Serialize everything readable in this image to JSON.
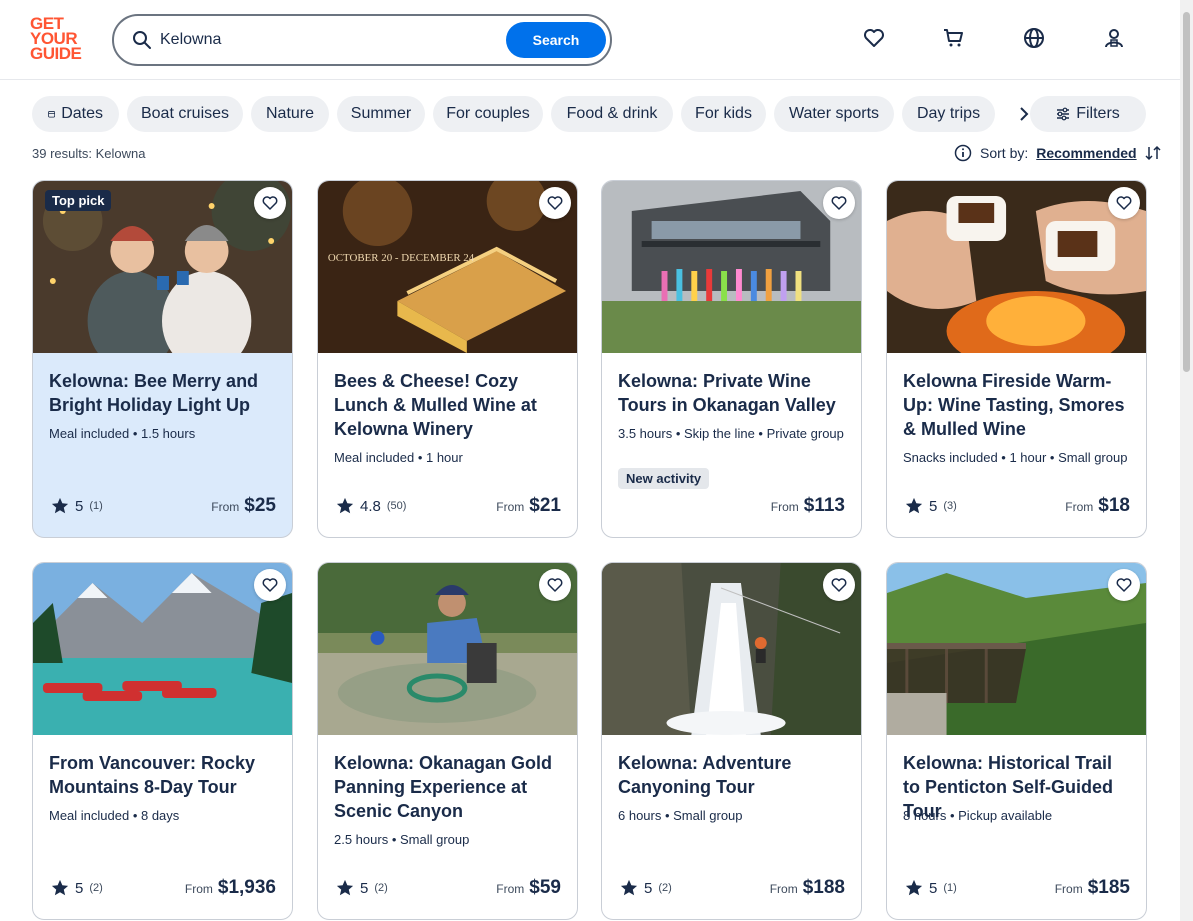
{
  "logo": {
    "line1": "GET",
    "line2": "YOUR",
    "line3": "GUIDE"
  },
  "search": {
    "value": "Kelowna",
    "button": "Search"
  },
  "chips": [
    "Dates",
    "Boat cruises",
    "Nature",
    "Summer",
    "For couples",
    "Food & drink",
    "For kids",
    "Water sports",
    "Day trips"
  ],
  "filters_label": "Filters",
  "results_text": "39 results: Kelowna",
  "sort": {
    "label": "Sort by:",
    "value": "Recommended"
  },
  "cards": [
    {
      "title": "Kelowna: Bee Merry and Bright Holiday Light Up",
      "meta": "Meal included • 1.5 hours",
      "badge": "Top pick",
      "new_badge": "",
      "rating": "5",
      "count": "(1)",
      "from": "From",
      "price": "$25"
    },
    {
      "title": "Bees & Cheese! Cozy Lunch & Mulled Wine at Kelowna Winery",
      "meta": "Meal included • 1 hour",
      "badge": "",
      "new_badge": "",
      "rating": "4.8",
      "count": "(50)",
      "from": "From",
      "price": "$21"
    },
    {
      "title": "Kelowna: Private Wine Tours in Okanagan Valley",
      "meta": "3.5 hours • Skip the line • Private group",
      "badge": "",
      "new_badge": "New activity",
      "rating": "",
      "count": "",
      "from": "From",
      "price": "$113"
    },
    {
      "title": "Kelowna Fireside Warm-Up: Wine Tasting, Smores & Mulled Wine",
      "meta": "Snacks included • 1 hour • Small group",
      "badge": "",
      "new_badge": "",
      "rating": "5",
      "count": "(3)",
      "from": "From",
      "price": "$18"
    },
    {
      "title": "From Vancouver: Rocky Mountains 8-Day Tour",
      "meta": "Meal included • 8 days",
      "badge": "",
      "new_badge": "",
      "rating": "5",
      "count": "(2)",
      "from": "From",
      "price": "$1,936"
    },
    {
      "title": "Kelowna: Okanagan Gold Panning Experience at Scenic Canyon",
      "meta": "2.5 hours • Small group",
      "badge": "",
      "new_badge": "",
      "rating": "5",
      "count": "(2)",
      "from": "From",
      "price": "$59"
    },
    {
      "title": "Kelowna: Adventure Canyoning Tour",
      "meta": "6 hours • Small group",
      "badge": "",
      "new_badge": "",
      "rating": "5",
      "count": "(2)",
      "from": "From",
      "price": "$188"
    },
    {
      "title": "Kelowna: Historical Trail to Penticton Self-Guided Tour",
      "meta": "8 hours • Pickup available",
      "badge": "",
      "new_badge": "",
      "rating": "5",
      "count": "(1)",
      "from": "From",
      "price": "$185"
    }
  ],
  "colors": {
    "brand": "#ff5533",
    "accent": "#0071eb",
    "text": "#1a2b49",
    "selected_card": "#dbeafb"
  },
  "icons": [
    "search-icon",
    "heart-icon",
    "cart-icon",
    "globe-icon",
    "account-icon",
    "calendar-icon",
    "chevron-right-icon",
    "filter-icon",
    "info-icon",
    "sort-icon",
    "star-icon"
  ]
}
